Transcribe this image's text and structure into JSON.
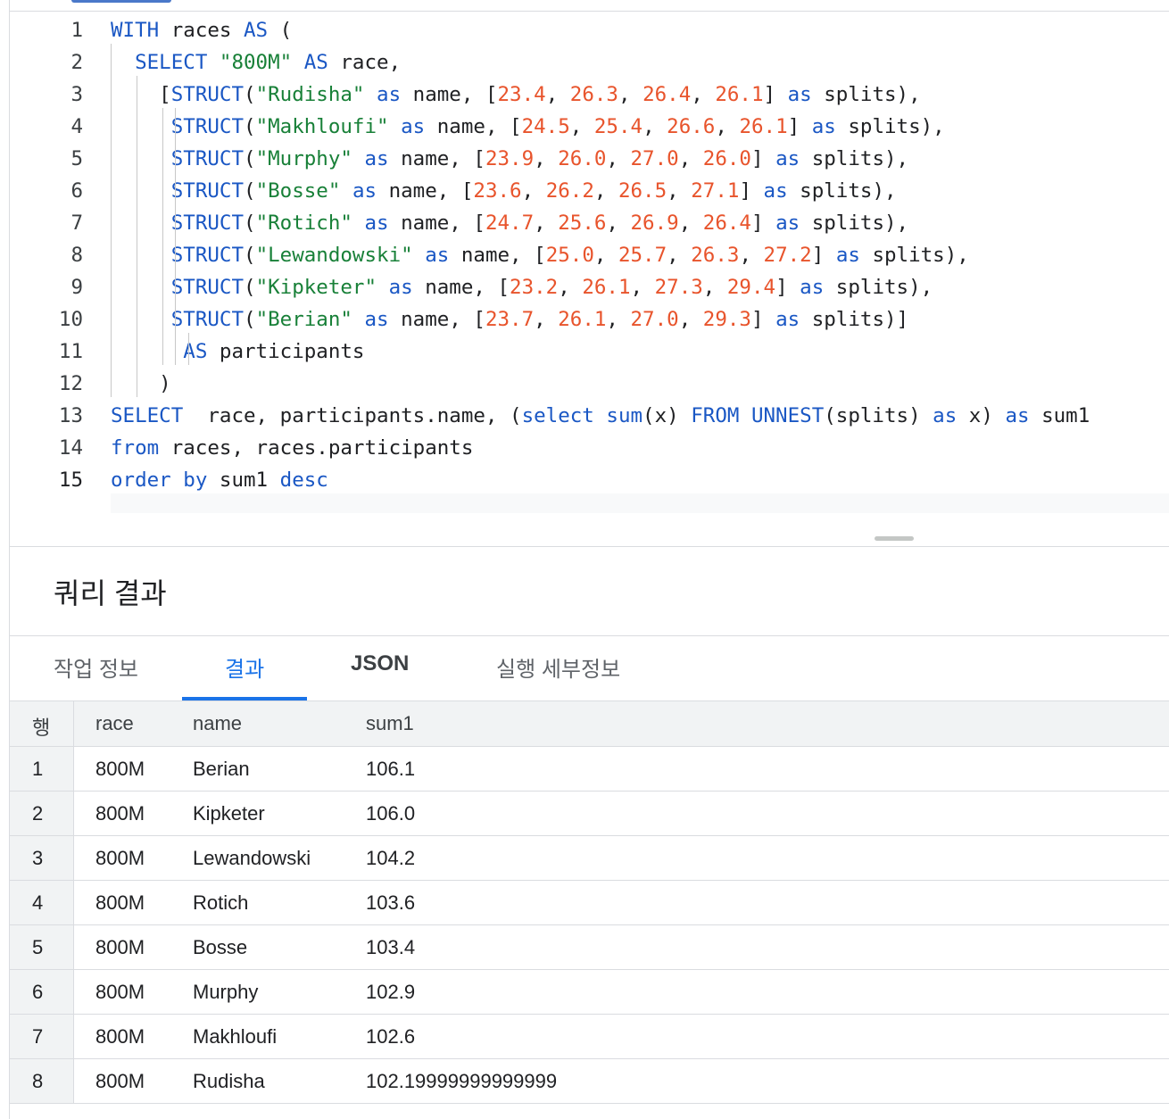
{
  "editor": {
    "lines": [
      {
        "n": "1",
        "tokens": [
          [
            "kw",
            "WITH"
          ],
          [
            "t",
            " races "
          ],
          [
            "kw",
            "AS"
          ],
          [
            "t",
            " ("
          ]
        ]
      },
      {
        "n": "2",
        "tokens": [
          [
            "t",
            "  "
          ],
          [
            "kw",
            "SELECT"
          ],
          [
            "t",
            " "
          ],
          [
            "str",
            "\"800M\""
          ],
          [
            "t",
            " "
          ],
          [
            "kw",
            "AS"
          ],
          [
            "t",
            " race,"
          ]
        ]
      },
      {
        "n": "3",
        "tokens": [
          [
            "t",
            "    ["
          ],
          [
            "kw",
            "STRUCT"
          ],
          [
            "t",
            "("
          ],
          [
            "str",
            "\"Rudisha\""
          ],
          [
            "t",
            " "
          ],
          [
            "kw",
            "as"
          ],
          [
            "t",
            " name, ["
          ],
          [
            "num",
            "23.4"
          ],
          [
            "t",
            ", "
          ],
          [
            "num",
            "26.3"
          ],
          [
            "t",
            ", "
          ],
          [
            "num",
            "26.4"
          ],
          [
            "t",
            ", "
          ],
          [
            "num",
            "26.1"
          ],
          [
            "t",
            "] "
          ],
          [
            "kw",
            "as"
          ],
          [
            "t",
            " splits),"
          ]
        ]
      },
      {
        "n": "4",
        "tokens": [
          [
            "t",
            "     "
          ],
          [
            "kw",
            "STRUCT"
          ],
          [
            "t",
            "("
          ],
          [
            "str",
            "\"Makhloufi\""
          ],
          [
            "t",
            " "
          ],
          [
            "kw",
            "as"
          ],
          [
            "t",
            " name, ["
          ],
          [
            "num",
            "24.5"
          ],
          [
            "t",
            ", "
          ],
          [
            "num",
            "25.4"
          ],
          [
            "t",
            ", "
          ],
          [
            "num",
            "26.6"
          ],
          [
            "t",
            ", "
          ],
          [
            "num",
            "26.1"
          ],
          [
            "t",
            "] "
          ],
          [
            "kw",
            "as"
          ],
          [
            "t",
            " splits),"
          ]
        ]
      },
      {
        "n": "5",
        "tokens": [
          [
            "t",
            "     "
          ],
          [
            "kw",
            "STRUCT"
          ],
          [
            "t",
            "("
          ],
          [
            "str",
            "\"Murphy\""
          ],
          [
            "t",
            " "
          ],
          [
            "kw",
            "as"
          ],
          [
            "t",
            " name, ["
          ],
          [
            "num",
            "23.9"
          ],
          [
            "t",
            ", "
          ],
          [
            "num",
            "26.0"
          ],
          [
            "t",
            ", "
          ],
          [
            "num",
            "27.0"
          ],
          [
            "t",
            ", "
          ],
          [
            "num",
            "26.0"
          ],
          [
            "t",
            "] "
          ],
          [
            "kw",
            "as"
          ],
          [
            "t",
            " splits),"
          ]
        ]
      },
      {
        "n": "6",
        "tokens": [
          [
            "t",
            "     "
          ],
          [
            "kw",
            "STRUCT"
          ],
          [
            "t",
            "("
          ],
          [
            "str",
            "\"Bosse\""
          ],
          [
            "t",
            " "
          ],
          [
            "kw",
            "as"
          ],
          [
            "t",
            " name, ["
          ],
          [
            "num",
            "23.6"
          ],
          [
            "t",
            ", "
          ],
          [
            "num",
            "26.2"
          ],
          [
            "t",
            ", "
          ],
          [
            "num",
            "26.5"
          ],
          [
            "t",
            ", "
          ],
          [
            "num",
            "27.1"
          ],
          [
            "t",
            "] "
          ],
          [
            "kw",
            "as"
          ],
          [
            "t",
            " splits),"
          ]
        ]
      },
      {
        "n": "7",
        "tokens": [
          [
            "t",
            "     "
          ],
          [
            "kw",
            "STRUCT"
          ],
          [
            "t",
            "("
          ],
          [
            "str",
            "\"Rotich\""
          ],
          [
            "t",
            " "
          ],
          [
            "kw",
            "as"
          ],
          [
            "t",
            " name, ["
          ],
          [
            "num",
            "24.7"
          ],
          [
            "t",
            ", "
          ],
          [
            "num",
            "25.6"
          ],
          [
            "t",
            ", "
          ],
          [
            "num",
            "26.9"
          ],
          [
            "t",
            ", "
          ],
          [
            "num",
            "26.4"
          ],
          [
            "t",
            "] "
          ],
          [
            "kw",
            "as"
          ],
          [
            "t",
            " splits),"
          ]
        ]
      },
      {
        "n": "8",
        "tokens": [
          [
            "t",
            "     "
          ],
          [
            "kw",
            "STRUCT"
          ],
          [
            "t",
            "("
          ],
          [
            "str",
            "\"Lewandowski\""
          ],
          [
            "t",
            " "
          ],
          [
            "kw",
            "as"
          ],
          [
            "t",
            " name, ["
          ],
          [
            "num",
            "25.0"
          ],
          [
            "t",
            ", "
          ],
          [
            "num",
            "25.7"
          ],
          [
            "t",
            ", "
          ],
          [
            "num",
            "26.3"
          ],
          [
            "t",
            ", "
          ],
          [
            "num",
            "27.2"
          ],
          [
            "t",
            "] "
          ],
          [
            "kw",
            "as"
          ],
          [
            "t",
            " splits),"
          ]
        ]
      },
      {
        "n": "9",
        "tokens": [
          [
            "t",
            "     "
          ],
          [
            "kw",
            "STRUCT"
          ],
          [
            "t",
            "("
          ],
          [
            "str",
            "\"Kipketer\""
          ],
          [
            "t",
            " "
          ],
          [
            "kw",
            "as"
          ],
          [
            "t",
            " name, ["
          ],
          [
            "num",
            "23.2"
          ],
          [
            "t",
            ", "
          ],
          [
            "num",
            "26.1"
          ],
          [
            "t",
            ", "
          ],
          [
            "num",
            "27.3"
          ],
          [
            "t",
            ", "
          ],
          [
            "num",
            "29.4"
          ],
          [
            "t",
            "] "
          ],
          [
            "kw",
            "as"
          ],
          [
            "t",
            " splits),"
          ]
        ]
      },
      {
        "n": "10",
        "tokens": [
          [
            "t",
            "     "
          ],
          [
            "kw",
            "STRUCT"
          ],
          [
            "t",
            "("
          ],
          [
            "str",
            "\"Berian\""
          ],
          [
            "t",
            " "
          ],
          [
            "kw",
            "as"
          ],
          [
            "t",
            " name, ["
          ],
          [
            "num",
            "23.7"
          ],
          [
            "t",
            ", "
          ],
          [
            "num",
            "26.1"
          ],
          [
            "t",
            ", "
          ],
          [
            "num",
            "27.0"
          ],
          [
            "t",
            ", "
          ],
          [
            "num",
            "29.3"
          ],
          [
            "t",
            "] "
          ],
          [
            "kw",
            "as"
          ],
          [
            "t",
            " splits)]"
          ]
        ]
      },
      {
        "n": "11",
        "tokens": [
          [
            "t",
            "      "
          ],
          [
            "kw",
            "AS"
          ],
          [
            "t",
            " participants"
          ]
        ]
      },
      {
        "n": "12",
        "tokens": [
          [
            "t",
            "    )"
          ]
        ]
      },
      {
        "n": "13",
        "tokens": [
          [
            "kw",
            "SELECT"
          ],
          [
            "t",
            "  race, participants.name, ("
          ],
          [
            "kw",
            "select"
          ],
          [
            "t",
            " "
          ],
          [
            "kw",
            "sum"
          ],
          [
            "t",
            "(x) "
          ],
          [
            "kw",
            "FROM"
          ],
          [
            "t",
            " "
          ],
          [
            "kw",
            "UNNEST"
          ],
          [
            "t",
            "(splits) "
          ],
          [
            "kw",
            "as"
          ],
          [
            "t",
            " x) "
          ],
          [
            "kw",
            "as"
          ],
          [
            "t",
            " sum1"
          ]
        ]
      },
      {
        "n": "14",
        "tokens": [
          [
            "kw",
            "from"
          ],
          [
            "t",
            " races, races.participants"
          ]
        ]
      },
      {
        "n": "15",
        "tokens": [
          [
            "kw",
            "order"
          ],
          [
            "t",
            " "
          ],
          [
            "kw",
            "by"
          ],
          [
            "t",
            " sum1 "
          ],
          [
            "kw",
            "desc"
          ]
        ]
      }
    ],
    "active_line": "15"
  },
  "results": {
    "title": "쿼리 결과",
    "tabs": [
      {
        "label": "작업 정보",
        "active": false
      },
      {
        "label": "결과",
        "active": true
      },
      {
        "label": "JSON",
        "active": false
      },
      {
        "label": "실행 세부정보",
        "active": false
      }
    ],
    "columns": [
      "행",
      "race",
      "name",
      "sum1"
    ],
    "rows": [
      [
        "1",
        "800M",
        "Berian",
        "106.1"
      ],
      [
        "2",
        "800M",
        "Kipketer",
        "106.0"
      ],
      [
        "3",
        "800M",
        "Lewandowski",
        "104.2"
      ],
      [
        "4",
        "800M",
        "Rotich",
        "103.6"
      ],
      [
        "5",
        "800M",
        "Bosse",
        "103.4"
      ],
      [
        "6",
        "800M",
        "Murphy",
        "102.9"
      ],
      [
        "7",
        "800M",
        "Makhloufi",
        "102.6"
      ],
      [
        "8",
        "800M",
        "Rudisha",
        "102.19999999999999"
      ]
    ]
  },
  "colors": {
    "keyword": "#1a57c4",
    "string": "#188038",
    "number": "#e8542c",
    "active_tab": "#1a73e8"
  }
}
